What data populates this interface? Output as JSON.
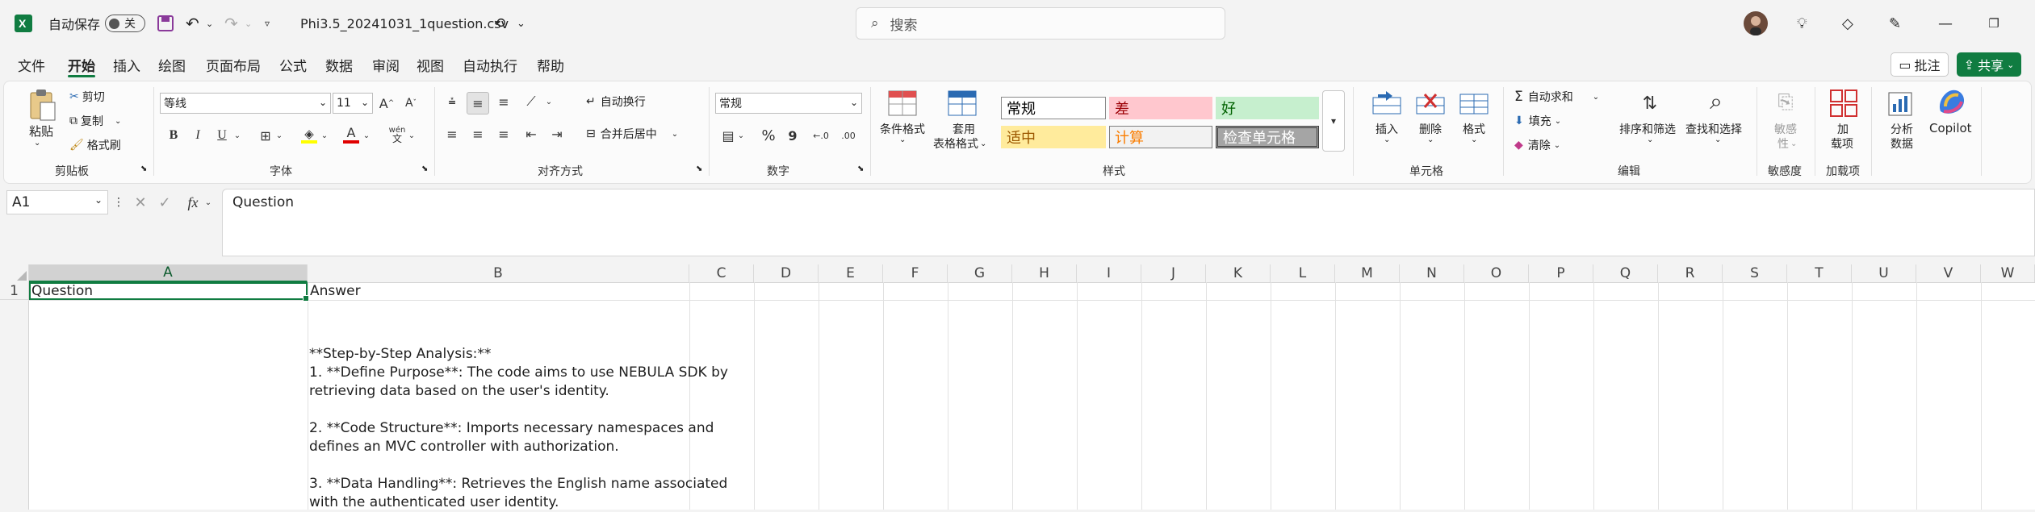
{
  "titlebar": {
    "autosave_label": "自动保存",
    "autosave_state": "关",
    "filename": "Phi3.5_20241031_1question.csv",
    "search_placeholder": "搜索"
  },
  "tabs": [
    "文件",
    "开始",
    "插入",
    "绘图",
    "页面布局",
    "公式",
    "数据",
    "审阅",
    "视图",
    "自动执行",
    "帮助"
  ],
  "active_tab": "开始",
  "comments_label": "批注",
  "share_label": "共享",
  "ribbon": {
    "clipboard": {
      "paste": "粘贴",
      "cut": "剪切",
      "copy": "复制",
      "format_painter": "格式刷",
      "group": "剪贴板"
    },
    "font": {
      "name": "等线",
      "size": "11",
      "group": "字体",
      "bold": "B",
      "italic": "I",
      "underline": "U",
      "phonetic": "wén"
    },
    "alignment": {
      "wrap": "自动换行",
      "merge": "合并后居中",
      "group": "对齐方式"
    },
    "number": {
      "format": "常规",
      "percent": "%",
      "comma": "9",
      "group": "数字"
    },
    "styles": {
      "conditional": "条件格式",
      "table_format_1": "套用",
      "table_format_2": "表格格式",
      "group": "样式",
      "cells": [
        {
          "label": "常规",
          "bg": "#ffffff",
          "color": "#000000",
          "border": "#8a8a8a"
        },
        {
          "label": "差",
          "bg": "#ffc7ce",
          "color": "#9c0006",
          "border": "#ffc7ce"
        },
        {
          "label": "好",
          "bg": "#c6efce",
          "color": "#006100",
          "border": "#c6efce"
        },
        {
          "label": "适中",
          "bg": "#ffeb9c",
          "color": "#9c5700",
          "border": "#ffeb9c"
        },
        {
          "label": "计算",
          "bg": "#f2f2f2",
          "color": "#fa7d00",
          "border": "#7f7f7f"
        },
        {
          "label": "检查单元格",
          "bg": "#a5a5a5",
          "color": "#ffffff",
          "border": "#3f3f3f"
        }
      ]
    },
    "cells_group": {
      "insert": "插入",
      "delete": "删除",
      "format": "格式",
      "group": "单元格"
    },
    "editing": {
      "autosum": "自动求和",
      "fill": "填充",
      "clear": "清除",
      "sort": "排序和筛选",
      "find": "查找和选择",
      "group": "编辑"
    },
    "sensitivity": {
      "label_1": "敏感",
      "label_2": "性",
      "group": "敏感度"
    },
    "addins": {
      "label_1": "加",
      "label_2": "载项",
      "group": "加载项"
    },
    "analyze": {
      "label_1": "分析",
      "label_2": "数据"
    },
    "copilot": "Copilot"
  },
  "formula_bar": {
    "name_box": "A1",
    "fx": "fx",
    "content": "Question"
  },
  "columns": [
    "A",
    "B",
    "C",
    "D",
    "E",
    "F",
    "G",
    "H",
    "I",
    "J",
    "K",
    "L",
    "M",
    "N",
    "O",
    "P",
    "Q",
    "R",
    "S",
    "T",
    "U",
    "V",
    "W"
  ],
  "rows": [
    "1"
  ],
  "cells": {
    "A1": "Question",
    "B1": "Answer",
    "B2_lines": [
      "**Step-by-Step Analysis:**",
      "1. **Define Purpose**: The code aims to use NEBULA SDK by",
      "retrieving data based on the user's identity.",
      "",
      "2. **Code Structure**: Imports necessary namespaces and",
      "defines an MVC controller with authorization.",
      "",
      "3. **Data Handling**: Retrieves the English name associated",
      "with the authenticated user identity."
    ]
  }
}
